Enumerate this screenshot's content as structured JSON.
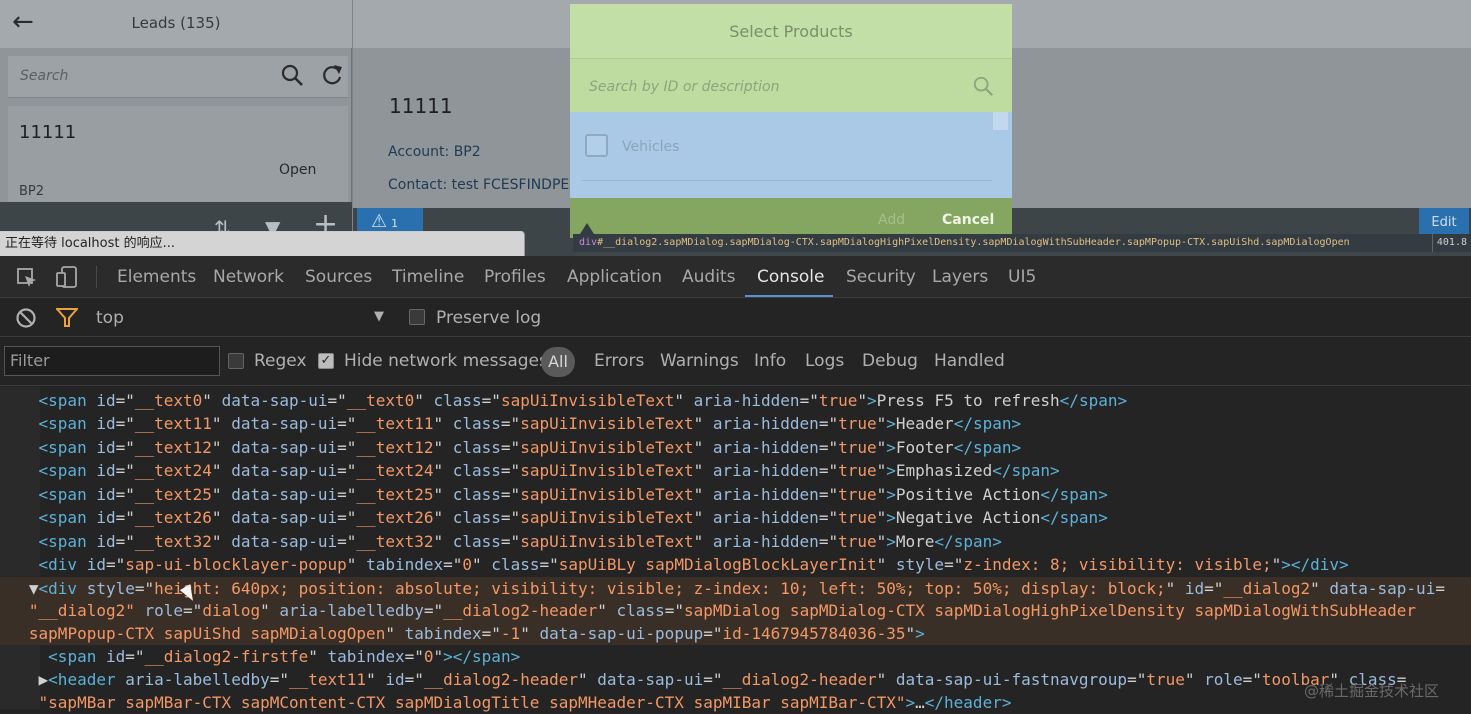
{
  "app": {
    "master": {
      "title": "Leads (135)",
      "search_placeholder": "Search",
      "lead": {
        "title": "11111",
        "status": "Open",
        "subtitle": "BP2"
      }
    },
    "detail": {
      "title": "11111",
      "account": "Account: BP2",
      "contact": "Contact: test FCESFINDPERSONS",
      "warn_count": "1",
      "edit_label": "Edit"
    },
    "dialog": {
      "title": "Select Products",
      "search_placeholder": "Search by ID or description",
      "item_label": "Vehicles",
      "add_label": "Add",
      "cancel_label": "Cancel"
    },
    "status_text": "正在等待 localhost 的响应..."
  },
  "tooltip": {
    "tag": "div",
    "selector": "#__dialog2.sapMDialog.sapMDialog-CTX.sapMDialogHighPixelDensity.sapMDialogWithSubHeader.sapMPopup-CTX.sapUiShd.sapMDialogOpen",
    "size": "401.8"
  },
  "devtools": {
    "tabs": [
      "Elements",
      "Network",
      "Sources",
      "Timeline",
      "Profiles",
      "Application",
      "Audits",
      "Console",
      "Security",
      "Layers",
      "UI5"
    ],
    "active_tab": "Console",
    "context": "top",
    "preserve_log_label": "Preserve log",
    "filter_placeholder": "Filter",
    "regex_label": "Regex",
    "hide_network_label": "Hide network messages",
    "hide_network_checked": true,
    "levels": [
      "All",
      "Errors",
      "Warnings",
      "Info",
      "Logs",
      "Debug",
      "Handled"
    ],
    "active_level": "All"
  },
  "console_lines": [
    {
      "indent": "    ",
      "parts": [
        [
          "tg",
          "<span "
        ],
        [
          "an",
          "id"
        ],
        [
          "tx",
          "=\""
        ],
        [
          "av",
          "__text0"
        ],
        [
          "tx",
          "\" "
        ],
        [
          "an",
          "data-sap-ui"
        ],
        [
          "tx",
          "=\""
        ],
        [
          "av",
          "__text0"
        ],
        [
          "tx",
          "\" "
        ],
        [
          "an",
          "class"
        ],
        [
          "tx",
          "=\""
        ],
        [
          "av",
          "sapUiInvisibleText"
        ],
        [
          "tx",
          "\" "
        ],
        [
          "an",
          "aria-hidden"
        ],
        [
          "tx",
          "=\""
        ],
        [
          "av",
          "true"
        ],
        [
          "tx",
          "\""
        ],
        [
          "tg",
          ">"
        ],
        [
          "tx",
          "Press F5 to refresh"
        ],
        [
          "tg",
          "</span>"
        ]
      ]
    },
    {
      "indent": "    ",
      "parts": [
        [
          "tg",
          "<span "
        ],
        [
          "an",
          "id"
        ],
        [
          "tx",
          "=\""
        ],
        [
          "av",
          "__text11"
        ],
        [
          "tx",
          "\" "
        ],
        [
          "an",
          "data-sap-ui"
        ],
        [
          "tx",
          "=\""
        ],
        [
          "av",
          "__text11"
        ],
        [
          "tx",
          "\" "
        ],
        [
          "an",
          "class"
        ],
        [
          "tx",
          "=\""
        ],
        [
          "av",
          "sapUiInvisibleText"
        ],
        [
          "tx",
          "\" "
        ],
        [
          "an",
          "aria-hidden"
        ],
        [
          "tx",
          "=\""
        ],
        [
          "av",
          "true"
        ],
        [
          "tx",
          "\""
        ],
        [
          "tg",
          ">"
        ],
        [
          "tx",
          "Header"
        ],
        [
          "tg",
          "</span>"
        ]
      ]
    },
    {
      "indent": "    ",
      "parts": [
        [
          "tg",
          "<span "
        ],
        [
          "an",
          "id"
        ],
        [
          "tx",
          "=\""
        ],
        [
          "av",
          "__text12"
        ],
        [
          "tx",
          "\" "
        ],
        [
          "an",
          "data-sap-ui"
        ],
        [
          "tx",
          "=\""
        ],
        [
          "av",
          "__text12"
        ],
        [
          "tx",
          "\" "
        ],
        [
          "an",
          "class"
        ],
        [
          "tx",
          "=\""
        ],
        [
          "av",
          "sapUiInvisibleText"
        ],
        [
          "tx",
          "\" "
        ],
        [
          "an",
          "aria-hidden"
        ],
        [
          "tx",
          "=\""
        ],
        [
          "av",
          "true"
        ],
        [
          "tx",
          "\""
        ],
        [
          "tg",
          ">"
        ],
        [
          "tx",
          "Footer"
        ],
        [
          "tg",
          "</span>"
        ]
      ]
    },
    {
      "indent": "    ",
      "parts": [
        [
          "tg",
          "<span "
        ],
        [
          "an",
          "id"
        ],
        [
          "tx",
          "=\""
        ],
        [
          "av",
          "__text24"
        ],
        [
          "tx",
          "\" "
        ],
        [
          "an",
          "data-sap-ui"
        ],
        [
          "tx",
          "=\""
        ],
        [
          "av",
          "__text24"
        ],
        [
          "tx",
          "\" "
        ],
        [
          "an",
          "class"
        ],
        [
          "tx",
          "=\""
        ],
        [
          "av",
          "sapUiInvisibleText"
        ],
        [
          "tx",
          "\" "
        ],
        [
          "an",
          "aria-hidden"
        ],
        [
          "tx",
          "=\""
        ],
        [
          "av",
          "true"
        ],
        [
          "tx",
          "\""
        ],
        [
          "tg",
          ">"
        ],
        [
          "tx",
          "Emphasized"
        ],
        [
          "tg",
          "</span>"
        ]
      ]
    },
    {
      "indent": "    ",
      "parts": [
        [
          "tg",
          "<span "
        ],
        [
          "an",
          "id"
        ],
        [
          "tx",
          "=\""
        ],
        [
          "av",
          "__text25"
        ],
        [
          "tx",
          "\" "
        ],
        [
          "an",
          "data-sap-ui"
        ],
        [
          "tx",
          "=\""
        ],
        [
          "av",
          "__text25"
        ],
        [
          "tx",
          "\" "
        ],
        [
          "an",
          "class"
        ],
        [
          "tx",
          "=\""
        ],
        [
          "av",
          "sapUiInvisibleText"
        ],
        [
          "tx",
          "\" "
        ],
        [
          "an",
          "aria-hidden"
        ],
        [
          "tx",
          "=\""
        ],
        [
          "av",
          "true"
        ],
        [
          "tx",
          "\""
        ],
        [
          "tg",
          ">"
        ],
        [
          "tx",
          "Positive Action"
        ],
        [
          "tg",
          "</span>"
        ]
      ]
    },
    {
      "indent": "    ",
      "parts": [
        [
          "tg",
          "<span "
        ],
        [
          "an",
          "id"
        ],
        [
          "tx",
          "=\""
        ],
        [
          "av",
          "__text26"
        ],
        [
          "tx",
          "\" "
        ],
        [
          "an",
          "data-sap-ui"
        ],
        [
          "tx",
          "=\""
        ],
        [
          "av",
          "__text26"
        ],
        [
          "tx",
          "\" "
        ],
        [
          "an",
          "class"
        ],
        [
          "tx",
          "=\""
        ],
        [
          "av",
          "sapUiInvisibleText"
        ],
        [
          "tx",
          "\" "
        ],
        [
          "an",
          "aria-hidden"
        ],
        [
          "tx",
          "=\""
        ],
        [
          "av",
          "true"
        ],
        [
          "tx",
          "\""
        ],
        [
          "tg",
          ">"
        ],
        [
          "tx",
          "Negative Action"
        ],
        [
          "tg",
          "</span>"
        ]
      ]
    },
    {
      "indent": "    ",
      "parts": [
        [
          "tg",
          "<span "
        ],
        [
          "an",
          "id"
        ],
        [
          "tx",
          "=\""
        ],
        [
          "av",
          "__text32"
        ],
        [
          "tx",
          "\" "
        ],
        [
          "an",
          "data-sap-ui"
        ],
        [
          "tx",
          "=\""
        ],
        [
          "av",
          "__text32"
        ],
        [
          "tx",
          "\" "
        ],
        [
          "an",
          "class"
        ],
        [
          "tx",
          "=\""
        ],
        [
          "av",
          "sapUiInvisibleText"
        ],
        [
          "tx",
          "\" "
        ],
        [
          "an",
          "aria-hidden"
        ],
        [
          "tx",
          "=\""
        ],
        [
          "av",
          "true"
        ],
        [
          "tx",
          "\""
        ],
        [
          "tg",
          ">"
        ],
        [
          "tx",
          "More"
        ],
        [
          "tg",
          "</span>"
        ]
      ]
    },
    {
      "indent": "    ",
      "parts": [
        [
          "tg",
          "<div "
        ],
        [
          "an",
          "id"
        ],
        [
          "tx",
          "=\""
        ],
        [
          "av",
          "sap-ui-blocklayer-popup"
        ],
        [
          "tx",
          "\" "
        ],
        [
          "an",
          "tabindex"
        ],
        [
          "tx",
          "=\""
        ],
        [
          "av",
          "0"
        ],
        [
          "tx",
          "\" "
        ],
        [
          "an",
          "class"
        ],
        [
          "tx",
          "=\""
        ],
        [
          "av",
          "sapUiBLy sapMDialogBlockLayerInit"
        ],
        [
          "tx",
          "\" "
        ],
        [
          "an",
          "style"
        ],
        [
          "tx",
          "=\""
        ],
        [
          "av",
          "z-index: 8; visibility: visible;"
        ],
        [
          "tx",
          "\""
        ],
        [
          "tg",
          "></div>"
        ]
      ]
    },
    {
      "indent": "   ▼",
      "hl": true,
      "parts": [
        [
          "tg",
          "<div "
        ],
        [
          "an",
          "style"
        ],
        [
          "tx",
          "=\""
        ],
        [
          "av",
          "height: 640px; position: absolute; visibility: visible; z-index: 10; left: 50%; top: 50%; display: block;"
        ],
        [
          "tx",
          "\" "
        ],
        [
          "an",
          "id"
        ],
        [
          "tx",
          "=\""
        ],
        [
          "av",
          "__dialog2"
        ],
        [
          "tx",
          "\" "
        ],
        [
          "an",
          "data-sap-ui"
        ],
        [
          "tx",
          "="
        ]
      ]
    },
    {
      "indent": "   ",
      "hl": true,
      "parts": [
        [
          "av",
          "\"__dialog2\""
        ],
        [
          "tx",
          " "
        ],
        [
          "an",
          "role"
        ],
        [
          "tx",
          "=\""
        ],
        [
          "av",
          "dialog"
        ],
        [
          "tx",
          "\" "
        ],
        [
          "an",
          "aria-labelledby"
        ],
        [
          "tx",
          "=\""
        ],
        [
          "av",
          "__dialog2-header"
        ],
        [
          "tx",
          "\" "
        ],
        [
          "an",
          "class"
        ],
        [
          "tx",
          "=\""
        ],
        [
          "av",
          "sapMDialog sapMDialog-CTX sapMDialogHighPixelDensity sapMDialogWithSubHeader"
        ]
      ]
    },
    {
      "indent": "   ",
      "hl": true,
      "parts": [
        [
          "av",
          "sapMPopup-CTX sapUiShd sapMDialogOpen"
        ],
        [
          "tx",
          "\" "
        ],
        [
          "an",
          "tabindex"
        ],
        [
          "tx",
          "=\""
        ],
        [
          "av",
          "-1"
        ],
        [
          "tx",
          "\" "
        ],
        [
          "an",
          "data-sap-ui-popup"
        ],
        [
          "tx",
          "=\""
        ],
        [
          "av",
          "id-1467945784036-35"
        ],
        [
          "tx",
          "\""
        ],
        [
          "tg",
          ">"
        ]
      ]
    },
    {
      "indent": "     ",
      "parts": [
        [
          "tg",
          "<span "
        ],
        [
          "an",
          "id"
        ],
        [
          "tx",
          "=\""
        ],
        [
          "av",
          "__dialog2-firstfe"
        ],
        [
          "tx",
          "\" "
        ],
        [
          "an",
          "tabindex"
        ],
        [
          "tx",
          "=\""
        ],
        [
          "av",
          "0"
        ],
        [
          "tx",
          "\""
        ],
        [
          "tg",
          "></span>"
        ]
      ]
    },
    {
      "indent": "    ▶",
      "parts": [
        [
          "tg",
          "<header "
        ],
        [
          "an",
          "aria-labelledby"
        ],
        [
          "tx",
          "=\""
        ],
        [
          "av",
          "__text11"
        ],
        [
          "tx",
          "\" "
        ],
        [
          "an",
          "id"
        ],
        [
          "tx",
          "=\""
        ],
        [
          "av",
          "__dialog2-header"
        ],
        [
          "tx",
          "\" "
        ],
        [
          "an",
          "data-sap-ui"
        ],
        [
          "tx",
          "=\""
        ],
        [
          "av",
          "__dialog2-header"
        ],
        [
          "tx",
          "\" "
        ],
        [
          "an",
          "data-sap-ui-fastnavgroup"
        ],
        [
          "tx",
          "=\""
        ],
        [
          "av",
          "true"
        ],
        [
          "tx",
          "\" "
        ],
        [
          "an",
          "role"
        ],
        [
          "tx",
          "=\""
        ],
        [
          "av",
          "toolbar"
        ],
        [
          "tx",
          "\" "
        ],
        [
          "an",
          "class"
        ],
        [
          "tx",
          "="
        ]
      ]
    },
    {
      "indent": "    ",
      "parts": [
        [
          "av",
          "\"sapMBar sapMBar-CTX sapMContent-CTX sapMDialogTitle sapMHeader-CTX sapMIBar sapMIBar-CTX\""
        ],
        [
          "tg",
          ">"
        ],
        [
          "tx",
          "…"
        ],
        [
          "tg",
          "</header>"
        ]
      ]
    }
  ],
  "watermark": "@稀土掘金技术社区"
}
